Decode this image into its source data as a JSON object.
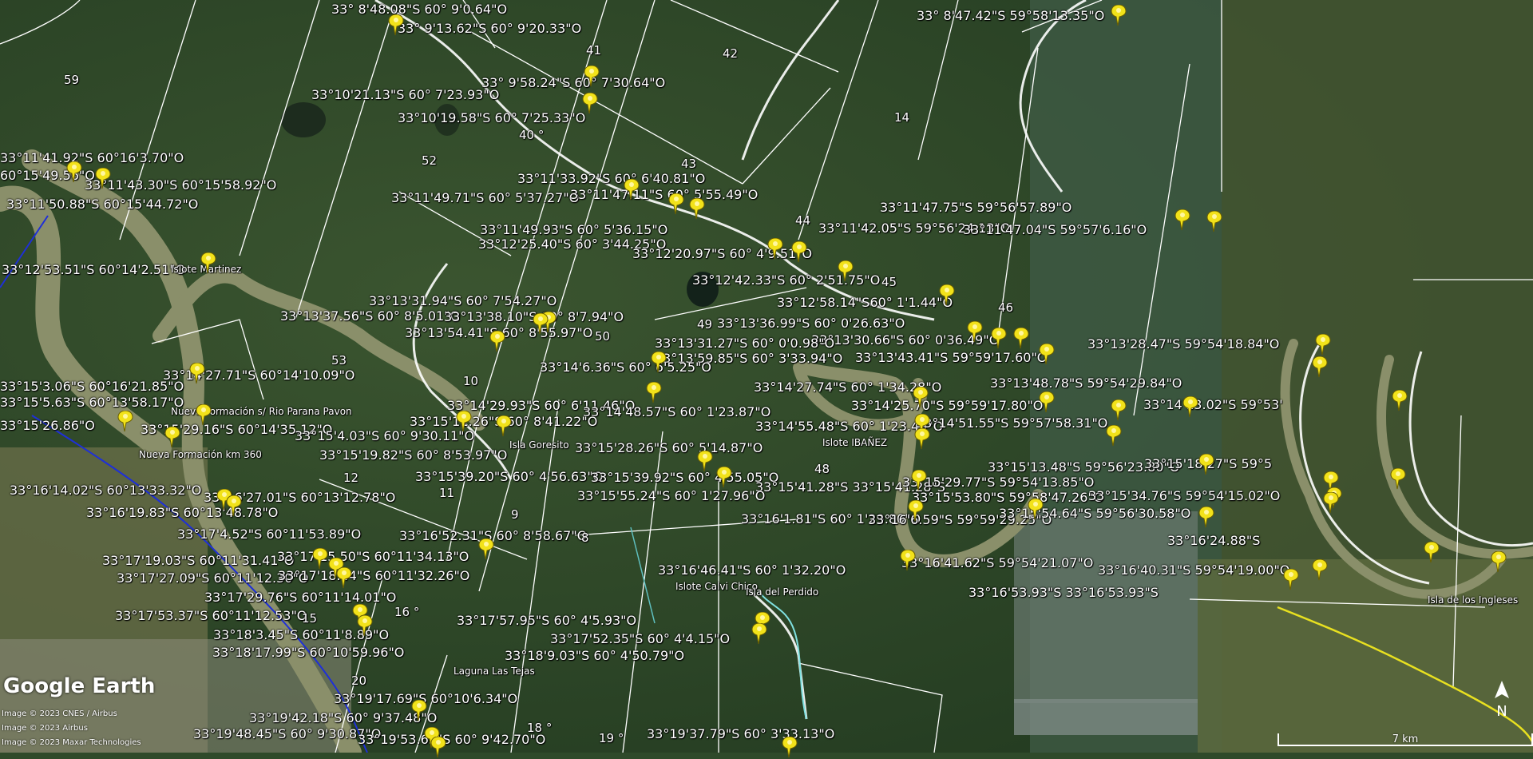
{
  "app": {
    "brand": "Google Earth"
  },
  "credits": [
    "Image © 2023 CNES / Airbus",
    "Image © 2023 Airbus",
    "Image © 2023 Maxar Technologies"
  ],
  "scale_label": "7 km",
  "north_label": "N",
  "region_numbers": [
    "59",
    "41",
    "42",
    "14",
    "40 °",
    "43",
    "52",
    "44",
    "45",
    "46",
    "49",
    "50",
    "53",
    "10",
    "48",
    "12",
    "11",
    "9",
    "8",
    "16 °",
    "15",
    "20",
    "18 °",
    "19 °"
  ],
  "coord_labels": [
    "33° 8'48.08\"S 60° 9'0.64\"O",
    "33° 9'13.62\"S 60° 9'20.33\"O",
    "33° 8'47.42\"S 59°58'13.35\"O",
    "33° 9'58.24\"S 60° 7'30.64\"O",
    "33°10'21.13\"S 60° 7'23.93\"O",
    "33°10'19.58\"S 60° 7'25.33\"O",
    "33°11'41.92\"S 60°16'3.70\"O",
    "60°15'49.56\"O",
    "33°11'43.30\"S 60°15'58.92\"O",
    "33°11'50.88\"S 60°15'44.72\"O",
    "33°11'33.92\"S 60° 6'40.81\"O",
    "33°11'49.71\"S 60° 5'37.27\"O",
    "33°11'47.11\"S 60° 5'55.49\"O",
    "33°11'47.75\"S 59°56'57.89\"O",
    "33°11'42.05\"S 59°56'24.13\"O",
    "33°11'47.04\"S 59°57'6.16\"O",
    "33°11'49.93\"S 60° 5'36.15\"O",
    "33°12'25.40\"S 60° 3'44.25\"O",
    "33°12'20.97\"S 60° 4'9.51\"O",
    "33°12'53.51\"S 60°14'2.51\"O",
    "33°12'42.33\"S 60° 2'51.75\"O",
    "33°12'58.14\"S60° 1'1.44\"O",
    "33°13'31.94\"S 60° 7'54.27\"O",
    "33°13'37.56\"S 60° 8'5.01\"O",
    "33°13'38.10\"S 60° 8'7.94\"O",
    "33°13'54.41\"S 60° 8'55.97\"O",
    "33°13'36.99\"S 60° 0'26.63\"O",
    "33°13'30.66\"S 60° 0'36.49\"O",
    "33°13'31.27\"S 60° 0'0.98\"O",
    "33°13'59.85\"S 60° 3'33.94\"O",
    "33°13'43.41\"S 59°59'17.60\"O",
    "33°13'28.47\"S 59°54'18.84\"O",
    "33°14'27.71\"S 60°14'10.09\"O",
    "33°14'6.36\"S 60° 6'5.25\"O",
    "33°13'48.78\"S 59°54'29.84\"O",
    "33°15'3.06\"S 60°16'21.85\"O",
    "33°15'5.63\"S 60°13'58.17\"O",
    "33°14'27.74\"S 60° 1'34.28\"O",
    "33°14'29.93\"S 60° 6'11.46\"O",
    "33°14'48.57\"S 60° 1'23.87\"O",
    "33°14'25.70\"S 59°59'17.80\"O",
    "33°14'13.02\"S 59°53'",
    "33°15'26.86\"O",
    "33°15'29.16\"S 60°14'35.12\"O",
    "33°15'11.26\"S 60° 8'41.22\"O",
    "33°15'4.03\"S 60° 9'30.11\"O",
    "33°14'55.48\"S 60° 1'23.49\"O",
    "33°14'51.55\"S 59°57'58.31\"O",
    "33°15'19.82\"S 60° 8'53.97\"O",
    "33°15'28.26\"S 60° 5'14.87\"O",
    "33°15'13.48\"S 59°56'23.80\"O",
    "33°15'18.27\"S 59°5",
    "33°15'39.20\"S 60° 4'56.63\"O",
    "33°15'39.92\"S 60° 4'55.05\"O",
    "33°15'41.28\"S 33°15'41.28\"S",
    "33°15'29.77\"S 59°54'13.85\"O",
    "33°16'14.02\"S 60°13'33.32\"O",
    "33°16'27.01\"S 60°13'12.78\"O",
    "33°15'55.24\"S 60° 1'27.96\"O",
    "33°15'53.80\"S 59°58'47.26\"O",
    "33°15'34.76\"S 59°54'15.02\"O",
    "33°16'19.83\"S 60°13'48.78\"O",
    "33°16'1.81\"S 60° 1'29.80\"O",
    "33°16'6.59\"S 59°59'29.25\"O",
    "33°15'54.64\"S 59°56'30.58\"O",
    "33°17'4.52\"S 60°11'53.89\"O",
    "33°16'52.31\"S 60° 8'58.67\"O",
    "33°16'24.88\"S",
    "33°17'19.03\"S 60°11'31.41\"O",
    "33°17'15.50\"S 60°11'34.13\"O",
    "33°16'41.62\"S 59°54'21.07\"O",
    "33°17'27.09\"S 60°11'12.30\"O",
    "33°17'18.44\"S 60°11'32.26\"O",
    "33°16'46.41\"S 60° 1'32.20\"O",
    "33°16'40.31\"S 59°54'19.00\"O",
    "33°17'29.76\"S 60°11'14.01\"O",
    "33°16'53.93\"S 33°16'53.93\"S",
    "33°17'53.37\"S 60°11'12.53\"O",
    "33°17'57.95\"S 60° 4'5.93\"O",
    "33°18'3.45\"S 60°11'8.89\"O",
    "33°17'52.35\"S 60° 4'4.15\"O",
    "33°18'17.99\"S 60°10'59.96\"O",
    "33°18'9.03\"S 60° 4'50.79\"O",
    "33°19'17.69\"S 60°10'6.34\"O",
    "33°19'42.18\"S 60° 9'37.48\"O",
    "33°19'48.45\"S 60° 9'30.87\"O",
    "33°19'53.65\"S 60° 9'42.70\"O",
    "33°19'37.79\"S 60° 3'33.13\"O"
  ],
  "place_labels": [
    "Islote Martinez",
    "Nueva Formación s/ Rio Parana Pavon",
    "Nueva Formación km 360",
    "Isla Goresito",
    "Islote IBAÑEZ",
    "Islote Calvi Chico",
    "Isla del Perdido",
    "Laguna Las Tejas",
    "Isla de los Ingleses"
  ],
  "colors": {
    "river": "#8a8f6a",
    "boundary": "#ffffff",
    "route_blue": "#1e2fd8",
    "route_yellow": "#e8e020",
    "pin": "#f2e21a"
  }
}
